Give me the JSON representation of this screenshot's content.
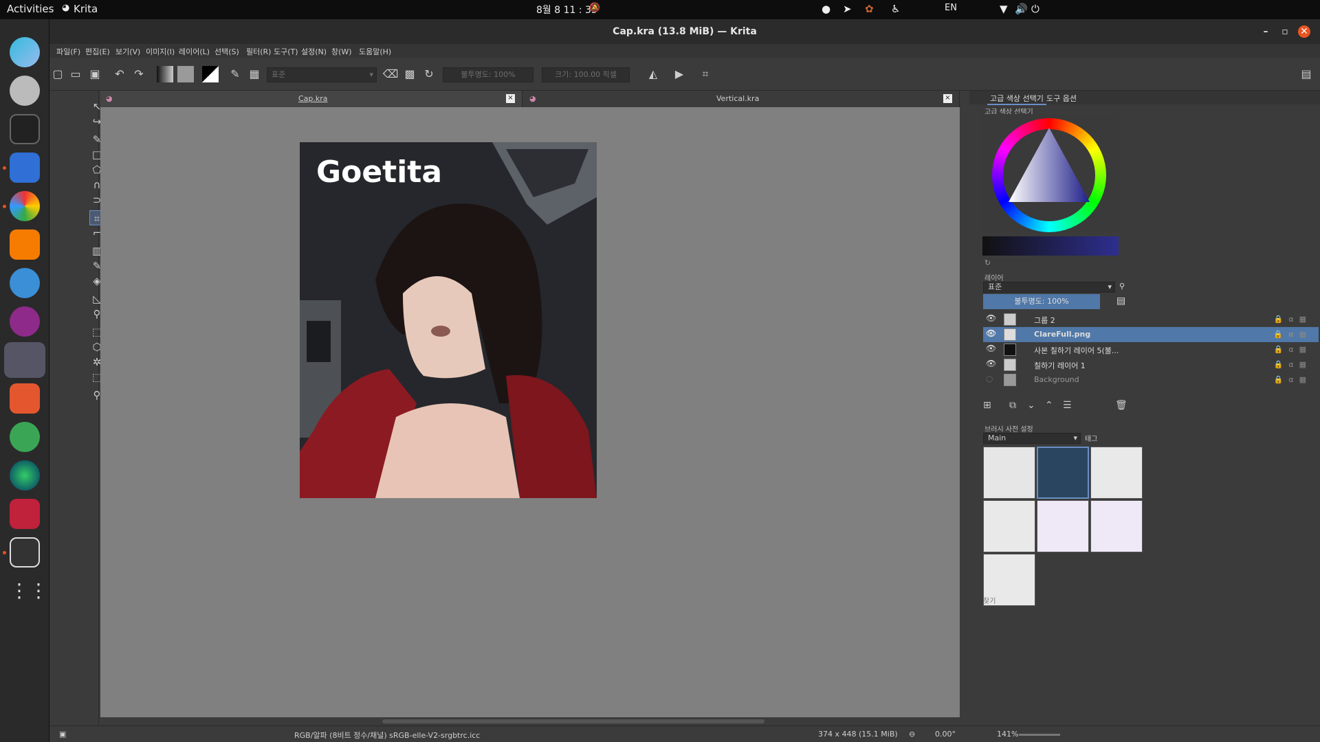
{
  "topbar": {
    "activities": "Activities",
    "app_name": "Krita",
    "clock": "8월 8  11 : 33",
    "lang": "EN"
  },
  "window": {
    "title": "Cap.kra (13.8 MiB)  — Krita"
  },
  "menu": [
    "파일(F)",
    "편집(E)",
    "보기(V)",
    "이미지(I)",
    "레이어(L)",
    "선택(S)",
    "필터(R)",
    "도구(T)",
    "설정(N)",
    "창(W)",
    "도움말(H)"
  ],
  "toolbar": {
    "blend_mode": "표준",
    "opacity": "불투명도: 100%",
    "size": "크기: 100.00 픽셀"
  },
  "tabs": [
    {
      "label": "Cap.kra"
    },
    {
      "label": "Vertical.kra"
    }
  ],
  "artwork": {
    "logo_text": "Goetita"
  },
  "status": {
    "color_info": "RGB/알파 (8비트 정수/채널)  sRGB-elle-V2-srgbtrc.icc",
    "dimensions": "374 x 448 (15.1 MiB)",
    "rotation": "0.00°",
    "zoom": "141%"
  },
  "right": {
    "tab_color": "고급 색상 선택기",
    "tab_tool": "도구 옵션",
    "color_panel_title": "고급 색상 선택기",
    "layers_title": "레이어",
    "layer_blend": "표준",
    "layer_opacity": "불투명도:  100%",
    "layers": [
      {
        "name": "그룹 2",
        "selected": false,
        "visible": true
      },
      {
        "name": "ClareFull.png",
        "selected": true,
        "visible": true
      },
      {
        "name": "사본 칠하기 레이어 5(불...",
        "selected": false,
        "visible": true
      },
      {
        "name": "칠하기 레이어 1",
        "selected": false,
        "visible": true
      },
      {
        "name": "Background",
        "selected": false,
        "visible": false
      }
    ],
    "brush_title": "브러시 사전 설정",
    "brush_group": "Main",
    "brush_tag": "태그",
    "search_placeholder": "찾기"
  }
}
